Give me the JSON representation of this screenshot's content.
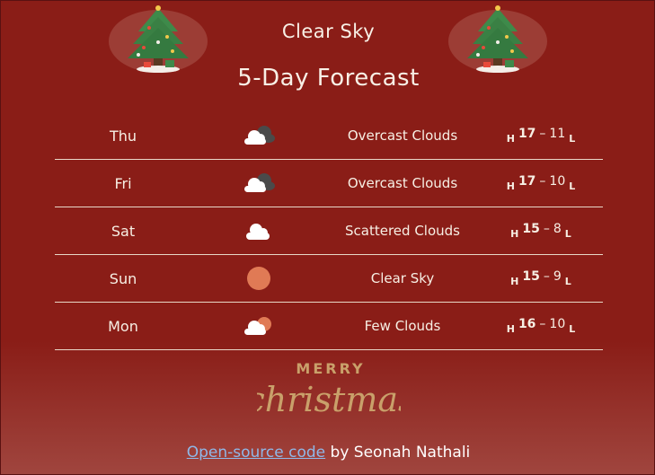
{
  "current": {
    "condition": "Clear Sky"
  },
  "forecast": {
    "heading": "5-Day Forecast",
    "days": [
      {
        "day": "Thu",
        "icon": "overcast-clouds-icon",
        "description": "Overcast Clouds",
        "high": "17",
        "low": "11"
      },
      {
        "day": "Fri",
        "icon": "overcast-clouds-icon",
        "description": "Overcast Clouds",
        "high": "17",
        "low": "10"
      },
      {
        "day": "Sat",
        "icon": "scattered-clouds-icon",
        "description": "Scattered Clouds",
        "high": "15",
        "low": "8"
      },
      {
        "day": "Sun",
        "icon": "sun-icon",
        "description": "Clear Sky",
        "high": "15",
        "low": "9"
      },
      {
        "day": "Mon",
        "icon": "few-clouds-icon",
        "description": "Few Clouds",
        "high": "16",
        "low": "10"
      }
    ],
    "high_label": "H",
    "low_label": "L",
    "separator": "–"
  },
  "decoration": {
    "line1": "MERRY",
    "line2": "christmas"
  },
  "footer": {
    "link_text": "Open-source code",
    "suffix": " by Seonah Nathali"
  },
  "colors": {
    "background": "#8a1d17",
    "sun": "#e07a55",
    "cloud": "#ffffff",
    "dark_cloud": "#4a4a4a",
    "accent_text": "#c9a06a",
    "link": "#8fb8e8"
  }
}
